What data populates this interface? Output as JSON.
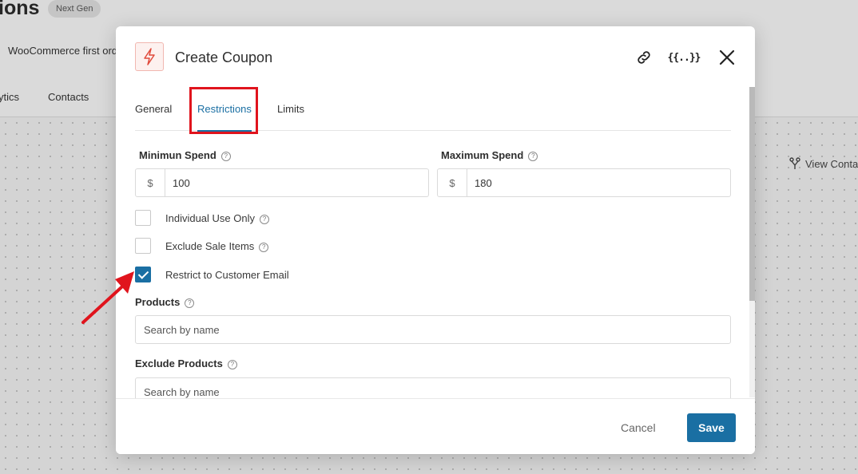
{
  "background": {
    "title": "ions",
    "badge": "Next Gen",
    "subtitle": "WooCommerce first ord",
    "nav": [
      "ytics",
      "Contacts"
    ],
    "view_link": "View Conta"
  },
  "modal": {
    "title": "Create Coupon",
    "tabs": [
      "General",
      "Restrictions",
      "Limits"
    ],
    "active_tab": "Restrictions",
    "minimum_spend": {
      "label": "Minimun Spend",
      "currency": "$",
      "value": "100"
    },
    "maximum_spend": {
      "label": "Maximum Spend",
      "currency": "$",
      "value": "180"
    },
    "checkboxes": [
      {
        "label": "Individual Use Only",
        "checked": false,
        "help": true
      },
      {
        "label": "Exclude Sale Items",
        "checked": false,
        "help": true
      },
      {
        "label": "Restrict to Customer Email",
        "checked": true,
        "help": false
      }
    ],
    "products": {
      "label": "Products",
      "placeholder": "Search by name"
    },
    "exclude_products": {
      "label": "Exclude Products",
      "placeholder": "Search by name"
    },
    "cancel_label": "Cancel",
    "save_label": "Save"
  },
  "icons": {
    "header_icon": "lightning-bolt-icon",
    "link": "link-icon",
    "variables": "merge-tags-icon",
    "close": "close-icon",
    "help": "question-circle-icon",
    "view": "branch-icon"
  },
  "colors": {
    "primary": "#1a6fa3",
    "highlight": "#e0141d",
    "icon_accent": "#e04a3c"
  }
}
